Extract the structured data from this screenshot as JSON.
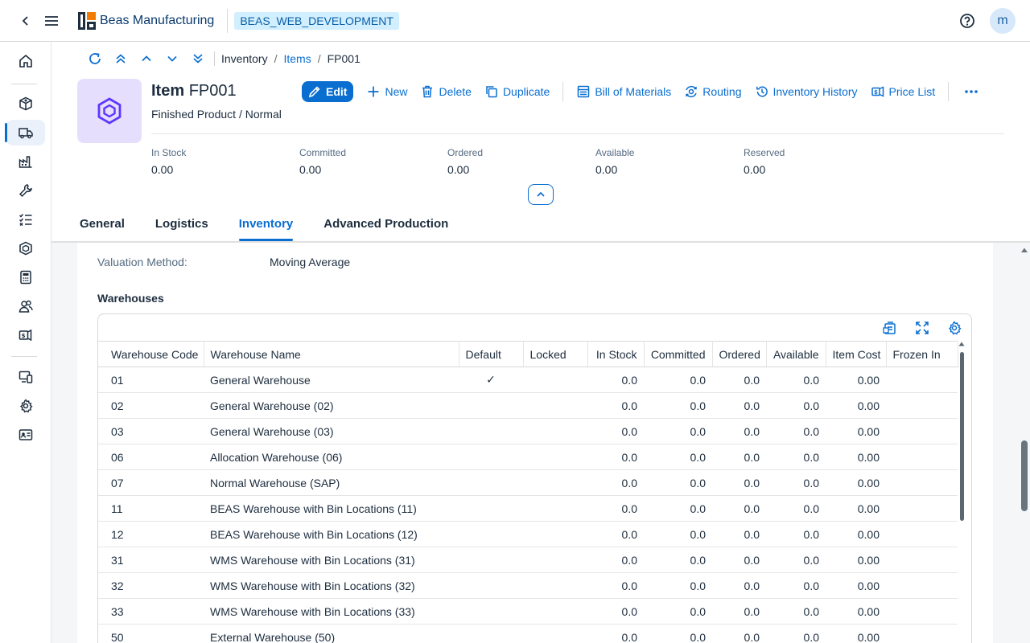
{
  "topbar": {
    "brand": "Beas Manufacturing",
    "environment": "BEAS_WEB_DEVELOPMENT",
    "avatar_initial": "m"
  },
  "sidenav": {
    "items": [
      "home-icon",
      "box-cube-icon",
      "truck-icon",
      "factory-icon",
      "wrench-icon",
      "checklist-icon",
      "product-icon",
      "calculator-icon",
      "people-icon",
      "price-tag-icon",
      "devices-icon",
      "gear-icon",
      "id-card-icon"
    ],
    "active": "truck-icon"
  },
  "breadcrumb": {
    "items": [
      "Inventory",
      "Items",
      "FP001"
    ]
  },
  "object": {
    "title_bold": "Item",
    "title_id": "FP001",
    "subtitle": "Finished Product / Normal"
  },
  "actions": {
    "edit": "Edit",
    "new": "New",
    "delete": "Delete",
    "duplicate": "Duplicate",
    "bom": "Bill of Materials",
    "routing": "Routing",
    "inventory_history": "Inventory History",
    "price_list": "Price List"
  },
  "kpis": [
    {
      "label": "In Stock",
      "value": "0.00"
    },
    {
      "label": "Committed",
      "value": "0.00"
    },
    {
      "label": "Ordered",
      "value": "0.00"
    },
    {
      "label": "Available",
      "value": "0.00"
    },
    {
      "label": "Reserved",
      "value": "0.00"
    }
  ],
  "tabs": [
    "General",
    "Logistics",
    "Inventory",
    "Advanced Production"
  ],
  "active_tab": "Inventory",
  "inventory": {
    "valuation_label": "Valuation Method:",
    "valuation_value": "Moving Average",
    "warehouses_title": "Warehouses"
  },
  "table": {
    "columns": [
      "Warehouse Code",
      "Warehouse Name",
      "Default",
      "Locked",
      "In Stock",
      "Committed",
      "Ordered",
      "Available",
      "Item Cost",
      "Frozen In"
    ],
    "rows": [
      [
        "01",
        "General Warehouse",
        "✓",
        "",
        "0.0",
        "0.0",
        "0.0",
        "0.0",
        "0.00",
        ""
      ],
      [
        "02",
        "General Warehouse (02)",
        "",
        "",
        "0.0",
        "0.0",
        "0.0",
        "0.0",
        "0.00",
        ""
      ],
      [
        "03",
        "General Warehouse (03)",
        "",
        "",
        "0.0",
        "0.0",
        "0.0",
        "0.0",
        "0.00",
        ""
      ],
      [
        "06",
        "Allocation Warehouse (06)",
        "",
        "",
        "0.0",
        "0.0",
        "0.0",
        "0.0",
        "0.00",
        ""
      ],
      [
        "07",
        "Normal Warehouse (SAP)",
        "",
        "",
        "0.0",
        "0.0",
        "0.0",
        "0.0",
        "0.00",
        ""
      ],
      [
        "11",
        "BEAS Warehouse with Bin Locations (11)",
        "",
        "",
        "0.0",
        "0.0",
        "0.0",
        "0.0",
        "0.00",
        ""
      ],
      [
        "12",
        "BEAS Warehouse with Bin Locations (12)",
        "",
        "",
        "0.0",
        "0.0",
        "0.0",
        "0.0",
        "0.00",
        ""
      ],
      [
        "31",
        "WMS Warehouse with Bin Locations (31)",
        "",
        "",
        "0.0",
        "0.0",
        "0.0",
        "0.0",
        "0.00",
        ""
      ],
      [
        "32",
        "WMS Warehouse with Bin Locations (32)",
        "",
        "",
        "0.0",
        "0.0",
        "0.0",
        "0.0",
        "0.00",
        ""
      ],
      [
        "33",
        "WMS Warehouse with Bin Locations (33)",
        "",
        "",
        "0.0",
        "0.0",
        "0.0",
        "0.0",
        "0.00",
        ""
      ],
      [
        "50",
        "External Warehouse (50)",
        "",
        "",
        "0.0",
        "0.0",
        "0.0",
        "0.0",
        "0.00",
        ""
      ]
    ]
  },
  "colors": {
    "accent": "#0a6ed1",
    "object_icon_bg": "#e5dffd",
    "object_icon_fg": "#5d36ff"
  }
}
